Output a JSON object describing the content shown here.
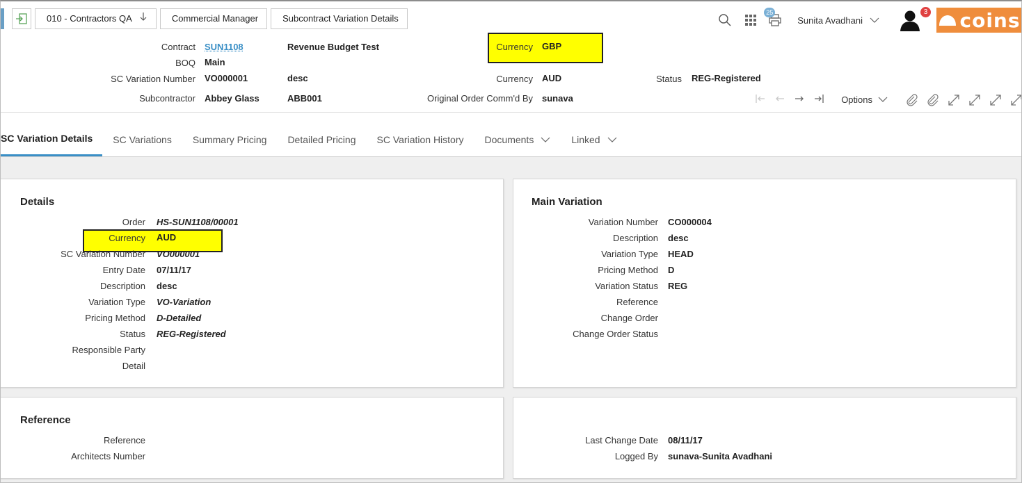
{
  "breadcrumb": {
    "company": "010 - Contractors QA",
    "role": "Commercial Manager",
    "page": "Subcontract Variation Details"
  },
  "topbar": {
    "print_badge": "25",
    "user_name": "Sunita Avadhani",
    "notification_count": "3",
    "logo_text": "coins"
  },
  "header_fields": {
    "contract_label": "Contract",
    "contract_value": "SUN1108",
    "contract_desc": "Revenue Budget Test",
    "currency1_label": "Currency",
    "currency1_value": "GBP",
    "boq_label": "BOQ",
    "boq_value": "Main",
    "scvar_label": "SC Variation Number",
    "scvar_value": "VO000001",
    "scvar_desc": "desc",
    "currency2_label": "Currency",
    "currency2_value": "AUD",
    "status_label": "Status",
    "status_value": "REG-Registered",
    "sub_label": "Subcontractor",
    "sub_value": "Abbey Glass",
    "sub_code": "ABB001",
    "orig_label": "Original Order Comm'd By",
    "orig_value": "sunava"
  },
  "actions": {
    "options_label": "Options"
  },
  "tabs": [
    {
      "label": "SC Variation Details"
    },
    {
      "label": "SC Variations"
    },
    {
      "label": "Summary Pricing"
    },
    {
      "label": "Detailed Pricing"
    },
    {
      "label": "SC Variation History"
    },
    {
      "label": "Documents"
    },
    {
      "label": "Linked"
    }
  ],
  "details": {
    "title": "Details",
    "rows": [
      {
        "label": "Order",
        "value": "HS-SUN1108/00001"
      },
      {
        "label": "Currency",
        "value": "AUD"
      },
      {
        "label": "SC Variation Number",
        "value": "VO000001"
      },
      {
        "label": "Entry Date",
        "value": "07/11/17"
      },
      {
        "label": "Description",
        "value": "desc"
      },
      {
        "label": "Variation Type",
        "value": "VO-Variation"
      },
      {
        "label": "Pricing Method",
        "value": "D-Detailed"
      },
      {
        "label": "Status",
        "value": "REG-Registered"
      },
      {
        "label": "Responsible Party",
        "value": ""
      },
      {
        "label": "Detail",
        "value": ""
      }
    ]
  },
  "main_variation": {
    "title": "Main Variation",
    "rows": [
      {
        "label": "Variation Number",
        "value": "CO000004"
      },
      {
        "label": "Description",
        "value": "desc"
      },
      {
        "label": "Variation Type",
        "value": "HEAD"
      },
      {
        "label": "Pricing Method",
        "value": "D"
      },
      {
        "label": "Variation Status",
        "value": "REG"
      },
      {
        "label": "Reference",
        "value": ""
      },
      {
        "label": "Change Order",
        "value": ""
      },
      {
        "label": "Change Order Status",
        "value": ""
      }
    ]
  },
  "reference": {
    "title": "Reference",
    "rows": [
      {
        "label": "Reference",
        "value": ""
      },
      {
        "label": "Architects Number",
        "value": ""
      }
    ]
  },
  "audit": {
    "rows": [
      {
        "label": "Last Change Date",
        "value": "08/11/17"
      },
      {
        "label": "Logged By",
        "value": "sunava-Sunita Avadhani"
      }
    ]
  },
  "colors": {
    "accent": "#3a8fc6",
    "highlight": "#ffff00",
    "logo_bg": "#ef8d3c",
    "badge": "#e04040"
  }
}
